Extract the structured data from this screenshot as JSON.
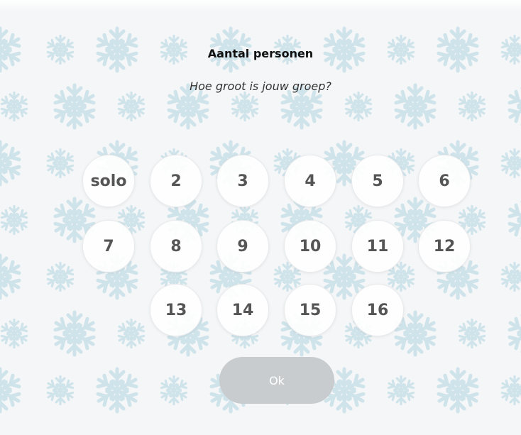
{
  "dialog": {
    "title": "Aantal personen",
    "subtitle": "Hoe groot is jouw groep?",
    "options": [
      "solo",
      "2",
      "3",
      "4",
      "5",
      "6",
      "7",
      "8",
      "9",
      "10",
      "11",
      "12",
      "13",
      "14",
      "15",
      "16"
    ],
    "ok_label": "Ok"
  },
  "background": {
    "pattern_icon": "snowflake-icon"
  },
  "colors": {
    "snowflake": "#cfe3ea",
    "ok_disabled": "#c9cccf"
  }
}
